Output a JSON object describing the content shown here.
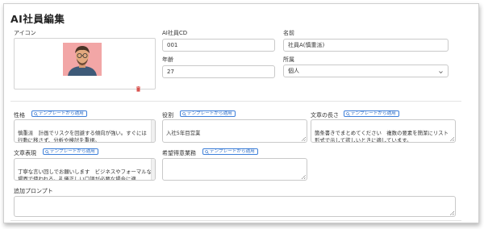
{
  "page": {
    "title": "AI社員編集"
  },
  "avatar": {
    "label": "アイコン"
  },
  "employee_cd": {
    "label": "AI社員CD",
    "value": "001"
  },
  "name": {
    "label": "名前",
    "value": "社員A(慎重派)"
  },
  "age": {
    "label": "年齢",
    "value": "27"
  },
  "department": {
    "label": "所属",
    "selected": "個人"
  },
  "template_button_label": "テンプレートから適用",
  "personality": {
    "label": "性格",
    "text": "慎重派　計画でリスクを回避する傾向が強い。すぐには\n行動に移さず、分析や検討を重視。"
  },
  "role": {
    "label": "役割",
    "text": "入社5年目営業"
  },
  "length": {
    "label": "文章の長さ",
    "text": "箇条書きでまとめてください　複数の要素を簡潔にリスト\n形式で示して欲しいときに適しています。"
  },
  "expression": {
    "label": "文章表現",
    "text": "丁寧な言い回しでお願いします　ビジネスやフォーマルな\n場面で使われる。礼儀正しい口調が必要な場合に適"
  },
  "desired_work": {
    "label": "希望得意業務",
    "text": ""
  },
  "extra_prompt": {
    "label": "追加プロンプト",
    "text": ""
  },
  "colors": {
    "accent": "#3d7fd9",
    "delete": "#d9534f",
    "avatar_bg": "#f2a6a6"
  },
  "icons": {
    "template": "search-icon",
    "delete": "trash-icon",
    "dropdown": "chevron-down-icon"
  }
}
